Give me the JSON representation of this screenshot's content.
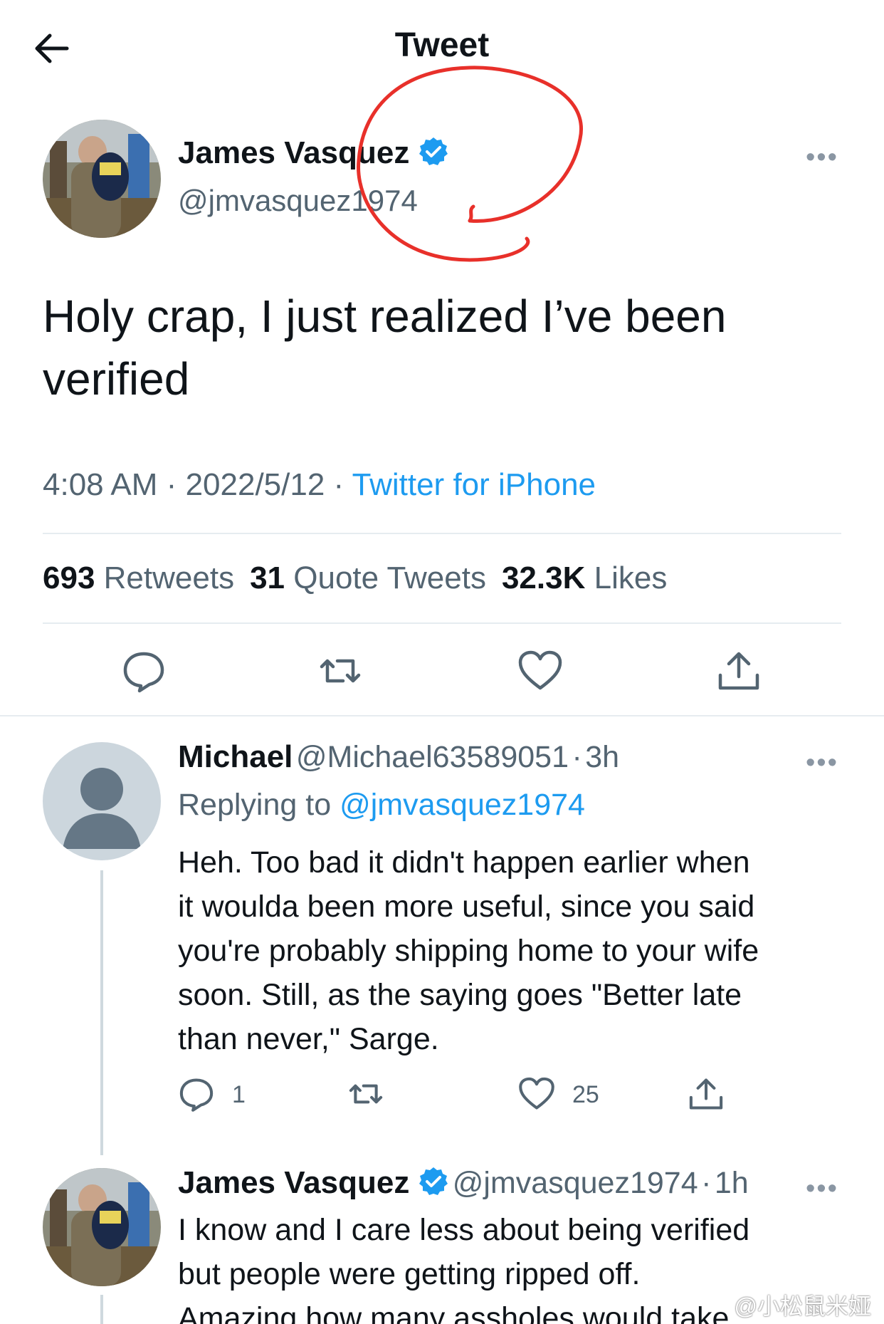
{
  "header": {
    "title": "Tweet"
  },
  "main_tweet": {
    "author_name": "James Vasquez",
    "author_handle": "@jmvasquez1974",
    "text": "Holy crap, I just realized I’ve been verified",
    "time": "4:08 AM",
    "date": "2022/5/12",
    "source": "Twitter for iPhone",
    "stats": {
      "retweets_count": "693",
      "retweets_label": "Retweets",
      "quotes_count": "31",
      "quotes_label": "Quote Tweets",
      "likes_count": "32.3K",
      "likes_label": "Likes"
    }
  },
  "reply1": {
    "author_name": "Michael",
    "author_handle": "@Michael63589051",
    "time": "3h",
    "replying_prefix": "Replying to",
    "replying_handle": "@jmvasquez1974",
    "lines": [
      "Heh. Too bad it didn't happen earlier when",
      "it woulda been more useful, since you said",
      "you're probably shipping home to your wife",
      "soon. Still, as the saying goes \"Better late",
      "than never,\" Sarge."
    ],
    "reply_count": "1",
    "like_count": "25"
  },
  "reply2": {
    "author_name": "James Vasquez",
    "author_handle": "@jmvasquez1974",
    "time": "1h",
    "lines": [
      "I know and I care less about being verified",
      "but people were getting ripped off.",
      "Amazing how many assholes would take"
    ]
  },
  "more_glyph": "•••",
  "separator": "·",
  "watermark": "@小松鼠米娅",
  "colors": {
    "link": "#1d9bf0",
    "annotation": "#e8302a",
    "muted": "#536471"
  }
}
